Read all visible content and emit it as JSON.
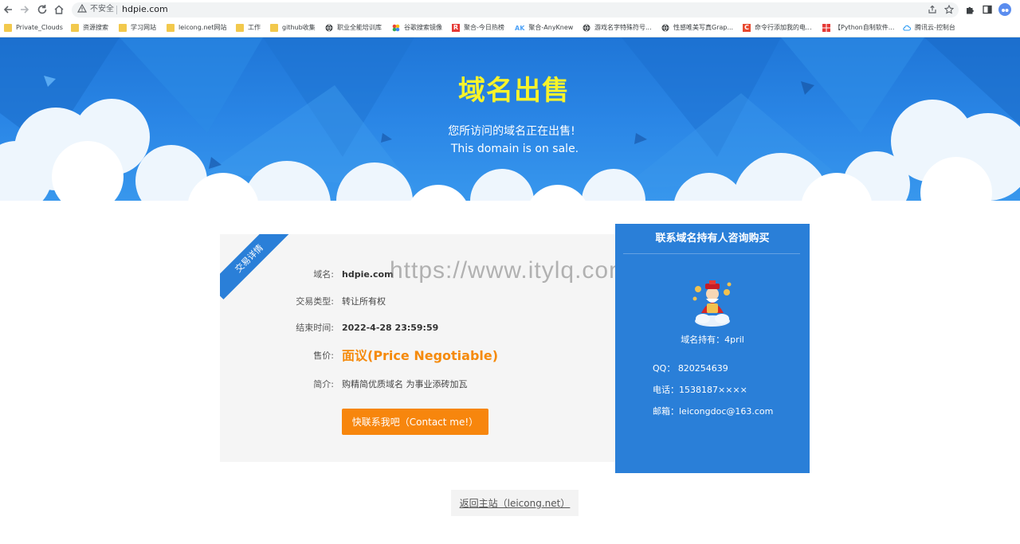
{
  "browser": {
    "security_label": "不安全",
    "url": "hdpie.com",
    "bookmarks": [
      {
        "label": "Private_Clouds",
        "icon": "folder-icon"
      },
      {
        "label": "资源搜索",
        "icon": "folder-icon"
      },
      {
        "label": "学习网站",
        "icon": "folder-icon"
      },
      {
        "label": "leicong.net网站",
        "icon": "folder-icon"
      },
      {
        "label": "工作",
        "icon": "folder-icon"
      },
      {
        "label": "github收集",
        "icon": "folder-icon"
      },
      {
        "label": "职业全能培训库",
        "icon": "globe-icon"
      },
      {
        "label": "谷歌搜索镜像",
        "icon": "site-icon"
      },
      {
        "label": "聚合-今日热榜",
        "icon": "site-icon"
      },
      {
        "label": "聚合-AnyKnew",
        "icon": "site-icon"
      },
      {
        "label": "游戏名字特殊符号...",
        "icon": "globe-icon"
      },
      {
        "label": "性感唯美写真Grap...",
        "icon": "globe-icon"
      },
      {
        "label": "命令行添加我的电...",
        "icon": "site-icon"
      },
      {
        "label": "【Python自制软件...",
        "icon": "site-icon"
      },
      {
        "label": "腾讯云-控制台",
        "icon": "cloud-icon"
      }
    ],
    "bookmark_badges": {
      "r": "R",
      "ak": "AK",
      "c": "C"
    }
  },
  "hero": {
    "title": "域名出售",
    "subtitle_cn": "您所访问的域名正在出售!",
    "subtitle_en": "This domain is on sale."
  },
  "detail": {
    "ribbon": "交易详情",
    "rows": [
      {
        "label": "域名:",
        "value": "hdpie.com"
      },
      {
        "label": "交易类型:",
        "value": "转让所有权"
      },
      {
        "label": "结束时间:",
        "value": "2022-4-28 23:59:59"
      },
      {
        "label": "售价:",
        "value": "面议(Price Negotiable)"
      },
      {
        "label": "简介:",
        "value": "购精简优质域名 为事业添砖加瓦"
      }
    ],
    "contact_button": "快联系我吧（Contact me!）"
  },
  "watermark": "https://www.itylq.com",
  "contact": {
    "title": "联系域名持有人咨询购买",
    "holder": "域名持有：4pril",
    "qq": "QQ：   820254639",
    "phone": "电话：1538187××××",
    "email": "邮箱：leicongdoc@163.com"
  },
  "footer": {
    "back_link": "返回主站（leicong.net）"
  },
  "colors": {
    "hero_blue": "#2a86e6",
    "title_yellow": "#f7f32b",
    "card_blue": "#2a7fd8",
    "orange": "#f7860d",
    "price_orange": "#f58a0b"
  }
}
